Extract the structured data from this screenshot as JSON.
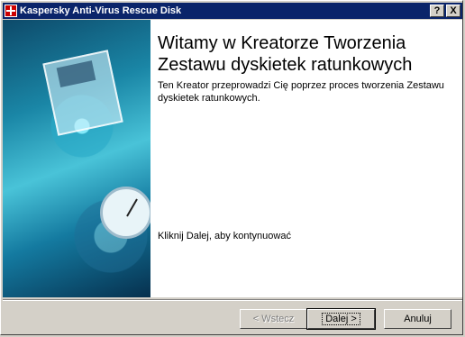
{
  "window": {
    "title": "Kaspersky Anti-Virus Rescue Disk",
    "help_button": "?",
    "close_button": "X"
  },
  "wizard": {
    "heading": "Witamy w Kreatorze Tworzenia Zestawu dyskietek ratunkowych",
    "intro": "Ten Kreator przeprowadzi Cię poprzez proces tworzenia Zestawu dyskietek ratunkowych.",
    "continue_hint": "Kliknij Dalej, aby kontynuować"
  },
  "buttons": {
    "back": "< Wstecz",
    "next": "Dalej >",
    "cancel": "Anuluj"
  }
}
